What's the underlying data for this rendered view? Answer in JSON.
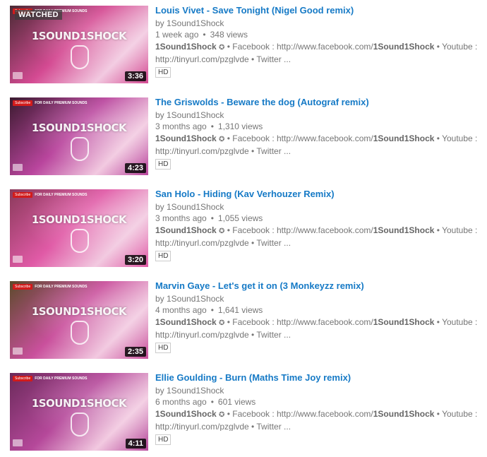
{
  "videos": [
    {
      "title": "Louis Vivet - Save Tonight (Nigel Good remix)",
      "channel": "by 1Sound1Shock",
      "age": "1 week ago",
      "views": "348 views",
      "duration": "3:36",
      "watched": "WATCHED",
      "badge": "HD",
      "desc_channel": "1Sound1Shock",
      "desc_rest_1": " • Facebook : http://www.facebook.com/",
      "desc_bold_2": "1Sound1Shock",
      "desc_rest_2": " • Youtube : http://tinyurl.com/pzglvde • Twitter ...",
      "thumb_color_a": "#d44a92",
      "thumb_color_b": "#4a2a34"
    },
    {
      "title": "The Griswolds - Beware the dog (Autograf remix)",
      "channel": "by 1Sound1Shock",
      "age": "3 months ago",
      "views": "1,310 views",
      "duration": "4:23",
      "watched": "",
      "badge": "HD",
      "desc_channel": "1Sound1Shock",
      "desc_rest_1": " • Facebook : http://www.facebook.com/",
      "desc_bold_2": "1Sound1Shock",
      "desc_rest_2": " • Youtube : http://tinyurl.com/pzglvde • Twitter ...",
      "thumb_color_a": "#b9459d",
      "thumb_color_b": "#3a1a2e"
    },
    {
      "title": "San Holo - Hiding (Kav Verhouzer Remix)",
      "channel": "by 1Sound1Shock",
      "age": "3 months ago",
      "views": "1,055 views",
      "duration": "3:20",
      "watched": "",
      "badge": "HD",
      "desc_channel": "1Sound1Shock",
      "desc_rest_1": " • Facebook : http://www.facebook.com/",
      "desc_bold_2": "1Sound1Shock",
      "desc_rest_2": " • Youtube : http://tinyurl.com/pzglvde • Twitter ...",
      "thumb_color_a": "#e05aa6",
      "thumb_color_b": "#8a3a5a"
    },
    {
      "title": "Marvin Gaye - Let's get it on (3 Monkeyzz remix)",
      "channel": "by 1Sound1Shock",
      "age": "4 months ago",
      "views": "1,641 views",
      "duration": "2:35",
      "watched": "",
      "badge": "HD",
      "desc_channel": "1Sound1Shock",
      "desc_rest_1": " • Facebook : http://www.facebook.com/",
      "desc_bold_2": "1Sound1Shock",
      "desc_rest_2": " • Youtube : http://tinyurl.com/pzglvde • Twitter ...",
      "thumb_color_a": "#c9509c",
      "thumb_color_b": "#5c4a2a"
    },
    {
      "title": "Ellie Goulding - Burn (Maths Time Joy remix)",
      "channel": "by 1Sound1Shock",
      "age": "6 months ago",
      "views": "601 views",
      "duration": "4:11",
      "watched": "",
      "badge": "HD",
      "desc_channel": "1Sound1Shock",
      "desc_rest_1": " • Facebook : http://www.facebook.com/",
      "desc_bold_2": "1Sound1Shock",
      "desc_rest_2": " • Youtube : http://tinyurl.com/pzglvde • Twitter ...",
      "thumb_color_a": "#b5489a",
      "thumb_color_b": "#6a2a5a"
    }
  ],
  "thumb_overlay": {
    "logo_text": "1SOUND1SHOCK",
    "subscribe_label": "Subscribe",
    "tagline": "FOR DAILY PREMIUM SOUNDS"
  },
  "verified_glyph": "✪",
  "separator": "•"
}
